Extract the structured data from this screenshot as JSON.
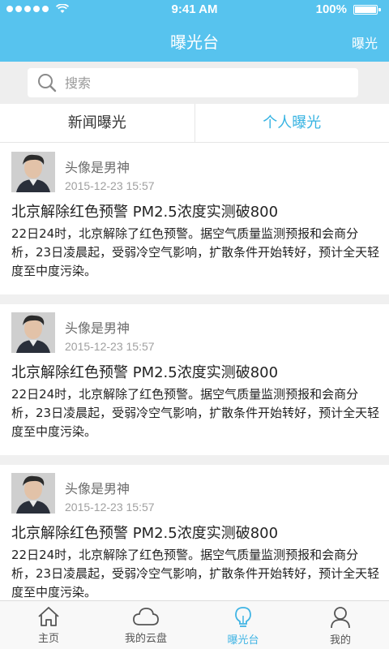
{
  "status_bar": {
    "time": "9:41 AM",
    "battery": "100%"
  },
  "navbar": {
    "title": "曝光台",
    "right_action": "曝光"
  },
  "search": {
    "placeholder": "搜索"
  },
  "tabs": [
    {
      "label": "新闻曝光",
      "active": false
    },
    {
      "label": "个人曝光",
      "active": true
    }
  ],
  "posts": [
    {
      "author": "头像是男神",
      "time": "2015-12-23  15:57",
      "title": "北京解除红色预警 PM2.5浓度实测破800",
      "summary": "22日24时，北京解除了红色预警。据空气质量监测预报和会商分析，23日凌晨起，受弱冷空气影响，扩散条件开始转好，预计全天轻度至中度污染。"
    },
    {
      "author": "头像是男神",
      "time": "2015-12-23  15:57",
      "title": "北京解除红色预警 PM2.5浓度实测破800",
      "summary": "22日24时，北京解除了红色预警。据空气质量监测预报和会商分析，23日凌晨起，受弱冷空气影响，扩散条件开始转好，预计全天轻度至中度污染。"
    },
    {
      "author": "头像是男神",
      "time": "2015-12-23  15:57",
      "title": "北京解除红色预警 PM2.5浓度实测破800",
      "summary": "22日24时，北京解除了红色预警。据空气质量监测预报和会商分析，23日凌晨起，受弱冷空气影响，扩散条件开始转好，预计全天轻度至中度污染。"
    }
  ],
  "tabbar": [
    {
      "label": "主页",
      "icon": "home-icon",
      "active": false
    },
    {
      "label": "我的云盘",
      "icon": "cloud-icon",
      "active": false
    },
    {
      "label": "曝光台",
      "icon": "lightbulb-icon",
      "active": true
    },
    {
      "label": "我的",
      "icon": "user-icon",
      "active": false
    }
  ],
  "colors": {
    "accent": "#57c3ee",
    "active_text": "#37b3e2"
  }
}
